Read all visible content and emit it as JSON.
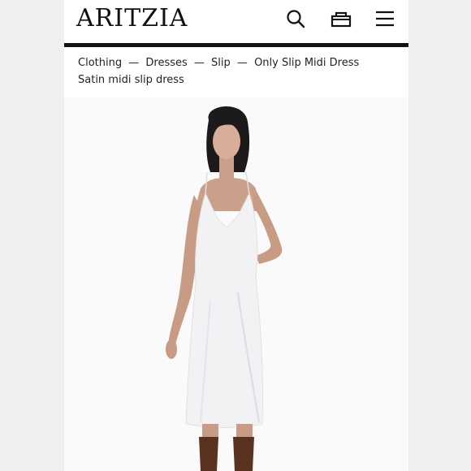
{
  "header": {
    "logo": "ARITZIA",
    "icons": [
      "search-icon",
      "bag-icon",
      "hamburger-menu-icon"
    ]
  },
  "breadcrumb": {
    "items": [
      "Clothing",
      "Dresses",
      "Slip",
      "Only Slip Midi Dress"
    ],
    "separator": "—"
  },
  "product": {
    "name": "Satin midi slip dress",
    "image": "model wearing white satin slip midi dress with brown boots"
  },
  "colors": {
    "background": "#efefef",
    "page": "#ffffff",
    "text": "#222222",
    "dress": "#f2f2f4",
    "boots": "#5a3220"
  }
}
